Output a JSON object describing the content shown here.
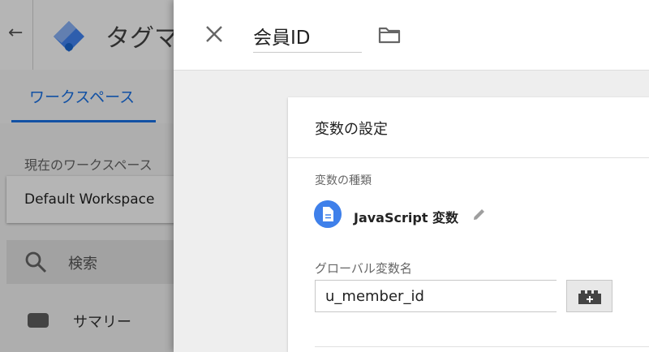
{
  "app": {
    "title": "タグマ",
    "tab_workspace": "ワークスペース",
    "workspace_caption": "現在のワークスペース",
    "workspace_name": "Default Workspace",
    "search_label": "検索",
    "nav_summary": "サマリー"
  },
  "panel": {
    "variable_name": "会員ID",
    "card_title": "変数の設定",
    "type_caption": "変数の種類",
    "type_label": "JavaScript 変数",
    "global_var_caption": "グローバル変数名",
    "global_var_value": "u_member_id"
  },
  "colors": {
    "accent": "#1a73e8",
    "type_icon": "#3f80ea",
    "logo": "#4285f4"
  },
  "icons": [
    "back-arrow-icon",
    "gtm-logo-icon",
    "search-icon",
    "summary-icon",
    "close-icon",
    "folder-icon",
    "document-icon",
    "pencil-icon",
    "variable-picker-icon"
  ]
}
